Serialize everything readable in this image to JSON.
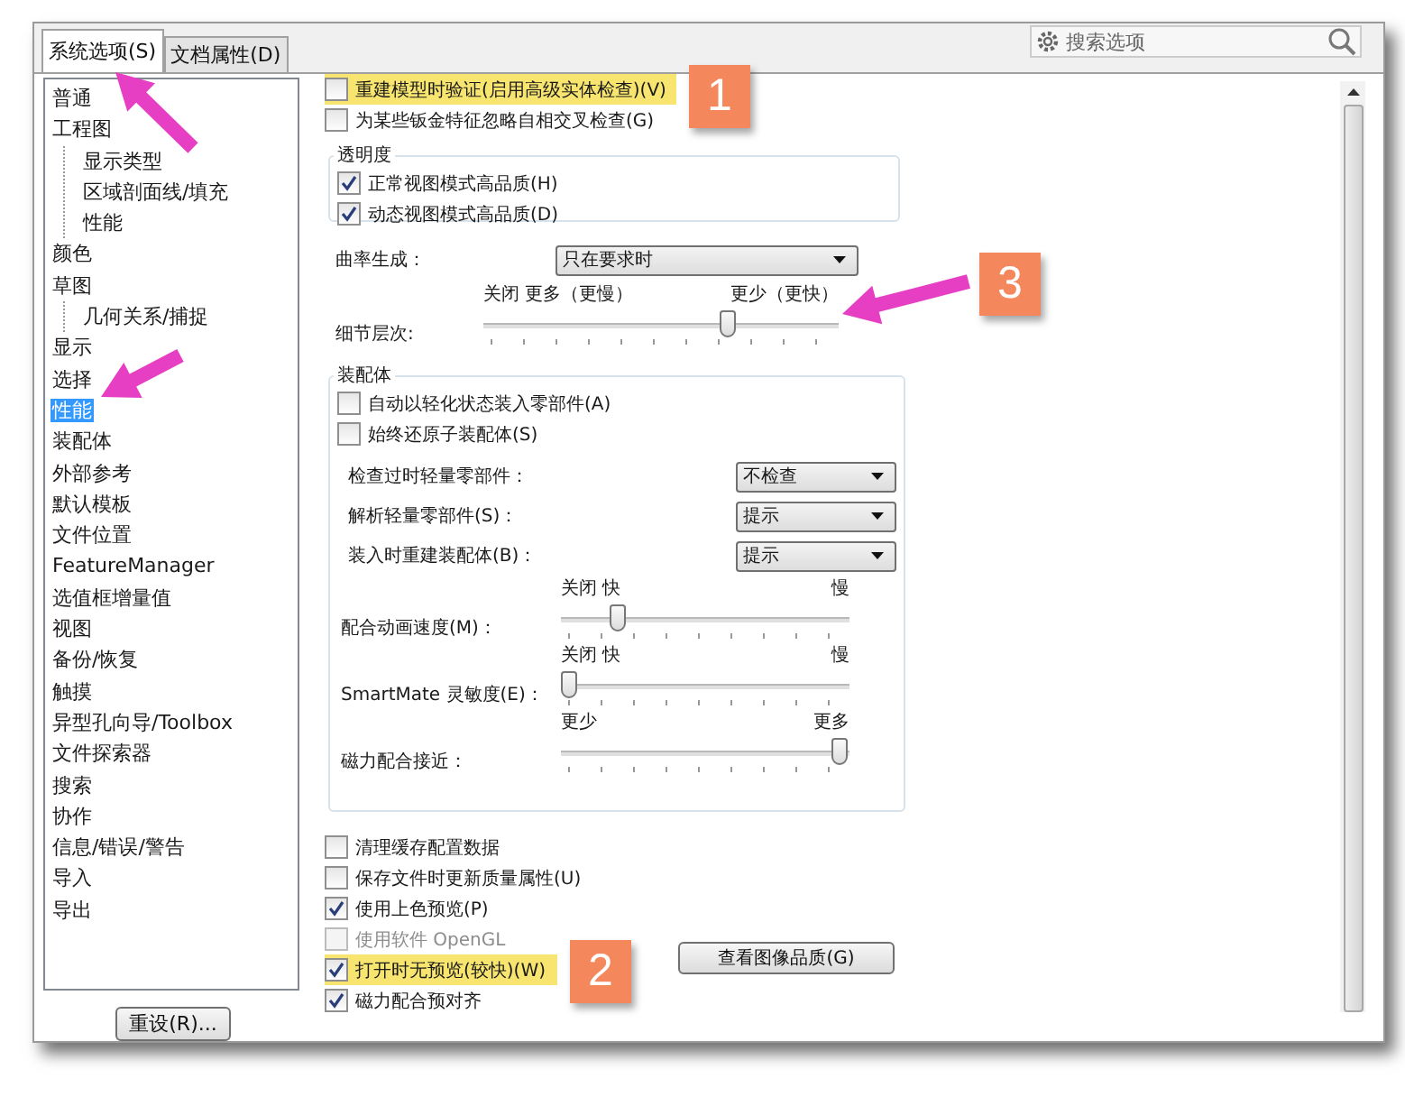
{
  "tabs": [
    {
      "label": "系统选项(S)",
      "selected": true
    },
    {
      "label": "文档属性(D)",
      "selected": false
    }
  ],
  "search": {
    "placeholder": "搜索选项"
  },
  "tree": [
    {
      "label": "普通",
      "selected": false
    },
    {
      "label": "工程图",
      "selected": false,
      "children": [
        {
          "label": "显示类型",
          "selected": false
        },
        {
          "label": "区域剖面线/填充",
          "selected": false
        },
        {
          "label": "性能",
          "selected": false
        }
      ]
    },
    {
      "label": "颜色",
      "selected": false
    },
    {
      "label": "草图",
      "selected": false,
      "children": [
        {
          "label": "几何关系/捕捉",
          "selected": false
        }
      ]
    },
    {
      "label": "显示",
      "selected": false
    },
    {
      "label": "选择",
      "selected": false
    },
    {
      "label": "性能",
      "selected": true
    },
    {
      "label": "装配体",
      "selected": false
    },
    {
      "label": "外部参考",
      "selected": false
    },
    {
      "label": "默认模板",
      "selected": false
    },
    {
      "label": "文件位置",
      "selected": false
    },
    {
      "label": "FeatureManager",
      "selected": false
    },
    {
      "label": "选值框增量值",
      "selected": false
    },
    {
      "label": "视图",
      "selected": false
    },
    {
      "label": "备份/恢复",
      "selected": false
    },
    {
      "label": "触摸",
      "selected": false
    },
    {
      "label": "异型孔向导/Toolbox",
      "selected": false
    },
    {
      "label": "文件探索器",
      "selected": false
    },
    {
      "label": "搜索",
      "selected": false
    },
    {
      "label": "协作",
      "selected": false
    },
    {
      "label": "信息/错误/警告",
      "selected": false
    },
    {
      "label": "导入",
      "selected": false
    },
    {
      "label": "导出",
      "selected": false
    }
  ],
  "reset_button": "重设(R)...",
  "top_checks": [
    {
      "label": "重建模型时验证(启用高级实体检查)(V)",
      "checked": false,
      "highlighted": true
    },
    {
      "label": "为某些钣金特征忽略自相交叉检查(G)",
      "checked": false,
      "highlighted": false
    }
  ],
  "transparency": {
    "title": "透明度",
    "checks": [
      {
        "label": "正常视图模式高品质(H)",
        "checked": true
      },
      {
        "label": "动态视图模式高品质(D)",
        "checked": true
      }
    ]
  },
  "curvature": {
    "label": "曲率生成：",
    "value": "只在要求时"
  },
  "detail": {
    "label": "细节层次:",
    "left_label": "关闭 更多（更慢）",
    "right_label": "更少（更快）",
    "level": 0.7
  },
  "assembly": {
    "title": "装配体",
    "checks": [
      {
        "label": "自动以轻化状态装入零部件(A)",
        "checked": false
      },
      {
        "label": "始终还原子装配体(S)",
        "checked": false
      }
    ],
    "dropdowns": [
      {
        "label": "检查过时轻量零部件：",
        "value": "不检查"
      },
      {
        "label": "解析轻量零部件(S)：",
        "value": "提示"
      },
      {
        "label": "装入时重建装配体(B)：",
        "value": "提示"
      }
    ],
    "sliders": [
      {
        "label": "配合动画速度(M)：",
        "left_label": "关闭 快",
        "right_label": "慢",
        "level": 0.18
      },
      {
        "label": "SmartMate 灵敏度(E)：",
        "left_label": "关闭 快",
        "right_label": "慢",
        "level": 0
      },
      {
        "label": "磁力配合接近：",
        "left_label": "更少",
        "right_label": "更多",
        "level": 1
      }
    ]
  },
  "bottom_checks": [
    {
      "label": "清理缓存配置数据",
      "checked": false,
      "disabled": false,
      "highlighted": false
    },
    {
      "label": "保存文件时更新质量属性(U)",
      "checked": false,
      "disabled": false,
      "highlighted": false
    },
    {
      "label": "使用上色预览(P)",
      "checked": true,
      "disabled": false,
      "highlighted": false
    },
    {
      "label": "使用软件 OpenGL",
      "checked": false,
      "disabled": true,
      "highlighted": false
    },
    {
      "label": "打开时无预览(较快)(W)",
      "checked": true,
      "disabled": false,
      "highlighted": true
    },
    {
      "label": "磁力配合预对齐",
      "checked": true,
      "disabled": false,
      "highlighted": false
    }
  ],
  "image_quality_button": "查看图像品质(G)",
  "callouts": [
    {
      "number": "1"
    },
    {
      "number": "2"
    },
    {
      "number": "3"
    }
  ]
}
